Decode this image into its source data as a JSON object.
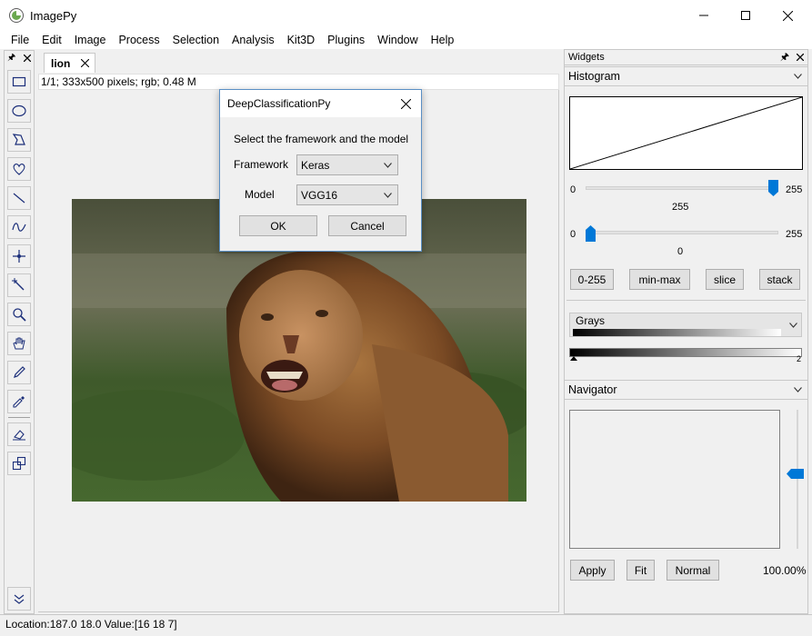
{
  "window": {
    "title": "ImagePy"
  },
  "menu": [
    "File",
    "Edit",
    "Image",
    "Process",
    "Selection",
    "Analysis",
    "Kit3D",
    "Plugins",
    "Window",
    "Help"
  ],
  "tools": [
    "rectangle-tool",
    "ellipse-tool",
    "polygon-tool",
    "freehand-tool",
    "line-tool",
    "freeline-tool",
    "point-tool",
    "magic-wand-tool",
    "zoom-tool",
    "hand-tool",
    "pencil-tool",
    "color-picker-tool",
    "fill-tool",
    "transform-tool",
    "more-tools"
  ],
  "tab": {
    "label": "lion"
  },
  "image_info": "1/1;  333x500 pixels; rgb; 0.48 M",
  "dialog": {
    "title": "DeepClassificationPy",
    "prompt": "Select the framework and the model",
    "framework_label": "Framework",
    "framework_value": "Keras",
    "model_label": "Model",
    "model_value": "VGG16",
    "ok_label": "OK",
    "cancel_label": "Cancel"
  },
  "widgets": {
    "title": "Widgets",
    "histogram_label": "Histogram",
    "slider1": {
      "min": "0",
      "max": "255",
      "value": "255",
      "fraction": 1.0
    },
    "slider2": {
      "min": "0",
      "max": "255",
      "value": "0",
      "fraction": 0.0
    },
    "buttons": [
      "0-255",
      "min-max",
      "slice",
      "stack"
    ],
    "lut_value": "Grays",
    "lut_max": "2",
    "navigator_label": "Navigator",
    "nav_buttons": [
      "Apply",
      "Fit",
      "Normal"
    ],
    "zoom": "100.00%"
  },
  "status": "Location:187.0 18.0  Value:[16 18  7]"
}
